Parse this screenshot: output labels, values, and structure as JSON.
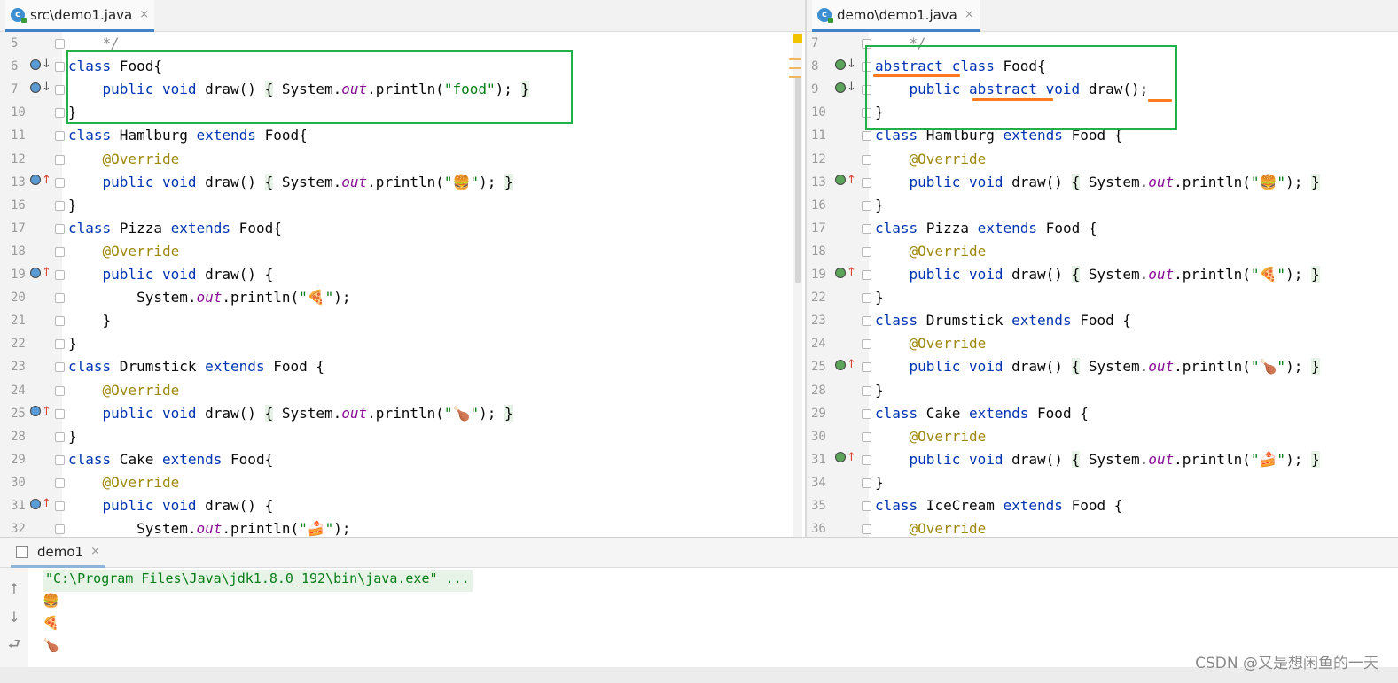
{
  "left_editor": {
    "tab": {
      "icon": "c",
      "filename": "src\\demo1.java",
      "close": "×"
    },
    "lines": [
      {
        "num": "5",
        "parts": [
          [
            "cm",
            "    */"
          ]
        ]
      },
      {
        "num": "6",
        "parts": [
          [
            "kw",
            "class"
          ],
          [
            "t",
            " Food{"
          ]
        ]
      },
      {
        "num": "7",
        "parts": [
          [
            "t",
            "    "
          ],
          [
            "kw",
            "public void"
          ],
          [
            "t",
            " draw() "
          ],
          [
            "fb",
            "{"
          ],
          [
            "t",
            " System."
          ],
          [
            "fld",
            "out"
          ],
          [
            "t",
            ".println("
          ],
          [
            "str",
            "\"food\""
          ],
          [
            "t",
            "); "
          ],
          [
            "fb",
            "}"
          ]
        ]
      },
      {
        "num": "10",
        "parts": [
          [
            "t",
            "}"
          ]
        ]
      },
      {
        "num": "11",
        "parts": [
          [
            "kw",
            "class"
          ],
          [
            "t",
            " Hamlburg "
          ],
          [
            "kw",
            "extends"
          ],
          [
            "t",
            " Food{"
          ]
        ]
      },
      {
        "num": "12",
        "parts": [
          [
            "t",
            "    "
          ],
          [
            "ann",
            "@Override"
          ]
        ]
      },
      {
        "num": "13",
        "parts": [
          [
            "t",
            "    "
          ],
          [
            "kw",
            "public void"
          ],
          [
            "t",
            " draw() "
          ],
          [
            "fb",
            "{"
          ],
          [
            "t",
            " System."
          ],
          [
            "fld",
            "out"
          ],
          [
            "t",
            ".println("
          ],
          [
            "str",
            "\"🍔\""
          ],
          [
            "t",
            "); "
          ],
          [
            "fb",
            "}"
          ]
        ]
      },
      {
        "num": "16",
        "parts": [
          [
            "t",
            "}"
          ]
        ]
      },
      {
        "num": "17",
        "parts": [
          [
            "kw",
            "class"
          ],
          [
            "t",
            " Pizza "
          ],
          [
            "kw",
            "extends"
          ],
          [
            "t",
            " Food{"
          ]
        ]
      },
      {
        "num": "18",
        "parts": [
          [
            "t",
            "    "
          ],
          [
            "ann",
            "@Override"
          ]
        ]
      },
      {
        "num": "19",
        "parts": [
          [
            "t",
            "    "
          ],
          [
            "kw",
            "public void"
          ],
          [
            "t",
            " draw() {"
          ]
        ]
      },
      {
        "num": "20",
        "parts": [
          [
            "t",
            "        System."
          ],
          [
            "fld",
            "out"
          ],
          [
            "t",
            ".println("
          ],
          [
            "str",
            "\"🍕\""
          ],
          [
            "t",
            ");"
          ]
        ]
      },
      {
        "num": "21",
        "parts": [
          [
            "t",
            "    }"
          ]
        ]
      },
      {
        "num": "22",
        "parts": [
          [
            "t",
            "}"
          ]
        ]
      },
      {
        "num": "23",
        "parts": [
          [
            "kw",
            "class"
          ],
          [
            "t",
            " Drumstick "
          ],
          [
            "kw",
            "extends"
          ],
          [
            "t",
            " Food {"
          ]
        ]
      },
      {
        "num": "24",
        "parts": [
          [
            "t",
            "    "
          ],
          [
            "ann",
            "@Override"
          ]
        ]
      },
      {
        "num": "25",
        "parts": [
          [
            "t",
            "    "
          ],
          [
            "kw",
            "public void"
          ],
          [
            "t",
            " draw() "
          ],
          [
            "fb",
            "{"
          ],
          [
            "t",
            " System."
          ],
          [
            "fld",
            "out"
          ],
          [
            "t",
            ".println("
          ],
          [
            "str",
            "\"🍗\""
          ],
          [
            "t",
            "); "
          ],
          [
            "fb",
            "}"
          ]
        ]
      },
      {
        "num": "28",
        "parts": [
          [
            "t",
            "}"
          ]
        ]
      },
      {
        "num": "29",
        "parts": [
          [
            "kw",
            "class"
          ],
          [
            "t",
            " Cake "
          ],
          [
            "kw",
            "extends"
          ],
          [
            "t",
            " Food{"
          ]
        ]
      },
      {
        "num": "30",
        "parts": [
          [
            "t",
            "    "
          ],
          [
            "ann",
            "@Override"
          ]
        ]
      },
      {
        "num": "31",
        "parts": [
          [
            "t",
            "    "
          ],
          [
            "kw",
            "public void"
          ],
          [
            "t",
            " draw() {"
          ]
        ]
      },
      {
        "num": "32",
        "parts": [
          [
            "t",
            "        System."
          ],
          [
            "fld",
            "out"
          ],
          [
            "t",
            ".println("
          ],
          [
            "str",
            "\"🍰\""
          ],
          [
            "t",
            ");"
          ]
        ]
      }
    ]
  },
  "right_editor": {
    "tab": {
      "icon": "c",
      "filename": "demo\\demo1.java",
      "close": "×"
    },
    "lines": [
      {
        "num": "7",
        "parts": [
          [
            "cm",
            "    */"
          ]
        ]
      },
      {
        "num": "8",
        "parts": [
          [
            "kw",
            "abstract class"
          ],
          [
            "t",
            " Food{"
          ]
        ]
      },
      {
        "num": "9",
        "parts": [
          [
            "t",
            "    "
          ],
          [
            "kw",
            "public abstract void"
          ],
          [
            "t",
            " draw();"
          ]
        ]
      },
      {
        "num": "10",
        "parts": [
          [
            "t",
            "}"
          ]
        ]
      },
      {
        "num": "11",
        "parts": [
          [
            "kw",
            "class"
          ],
          [
            "t",
            " Hamlburg "
          ],
          [
            "kw",
            "extends"
          ],
          [
            "t",
            " Food {"
          ]
        ]
      },
      {
        "num": "12",
        "parts": [
          [
            "t",
            "    "
          ],
          [
            "ann",
            "@Override"
          ]
        ]
      },
      {
        "num": "13",
        "parts": [
          [
            "t",
            "    "
          ],
          [
            "kw",
            "public void"
          ],
          [
            "t",
            " draw() "
          ],
          [
            "fb",
            "{"
          ],
          [
            "t",
            " System."
          ],
          [
            "fld",
            "out"
          ],
          [
            "t",
            ".println("
          ],
          [
            "str",
            "\"🍔\""
          ],
          [
            "t",
            "); "
          ],
          [
            "fb",
            "}"
          ]
        ]
      },
      {
        "num": "16",
        "parts": [
          [
            "t",
            "}"
          ]
        ]
      },
      {
        "num": "17",
        "parts": [
          [
            "kw",
            "class"
          ],
          [
            "t",
            " Pizza "
          ],
          [
            "kw",
            "extends"
          ],
          [
            "t",
            " Food {"
          ]
        ]
      },
      {
        "num": "18",
        "parts": [
          [
            "t",
            "    "
          ],
          [
            "ann",
            "@Override"
          ]
        ]
      },
      {
        "num": "19",
        "parts": [
          [
            "t",
            "    "
          ],
          [
            "kw",
            "public void"
          ],
          [
            "t",
            " draw() "
          ],
          [
            "fb",
            "{"
          ],
          [
            "t",
            " System."
          ],
          [
            "fld",
            "out"
          ],
          [
            "t",
            ".println("
          ],
          [
            "str",
            "\"🍕\""
          ],
          [
            "t",
            "); "
          ],
          [
            "fb",
            "}"
          ]
        ]
      },
      {
        "num": "22",
        "parts": [
          [
            "t",
            "}"
          ]
        ]
      },
      {
        "num": "23",
        "parts": [
          [
            "kw",
            "class"
          ],
          [
            "t",
            " Drumstick "
          ],
          [
            "kw",
            "extends"
          ],
          [
            "t",
            " Food {"
          ]
        ]
      },
      {
        "num": "24",
        "parts": [
          [
            "t",
            "    "
          ],
          [
            "ann",
            "@Override"
          ]
        ]
      },
      {
        "num": "25",
        "parts": [
          [
            "t",
            "    "
          ],
          [
            "kw",
            "public void"
          ],
          [
            "t",
            " draw() "
          ],
          [
            "fb",
            "{"
          ],
          [
            "t",
            " System."
          ],
          [
            "fld",
            "out"
          ],
          [
            "t",
            ".println("
          ],
          [
            "str",
            "\"🍗\""
          ],
          [
            "t",
            "); "
          ],
          [
            "fb",
            "}"
          ]
        ]
      },
      {
        "num": "28",
        "parts": [
          [
            "t",
            "}"
          ]
        ]
      },
      {
        "num": "29",
        "parts": [
          [
            "kw",
            "class"
          ],
          [
            "t",
            " Cake "
          ],
          [
            "kw",
            "extends"
          ],
          [
            "t",
            " Food {"
          ]
        ]
      },
      {
        "num": "30",
        "parts": [
          [
            "t",
            "    "
          ],
          [
            "ann",
            "@Override"
          ]
        ]
      },
      {
        "num": "31",
        "parts": [
          [
            "t",
            "    "
          ],
          [
            "kw",
            "public void"
          ],
          [
            "t",
            " draw() "
          ],
          [
            "fb",
            "{"
          ],
          [
            "t",
            " System."
          ],
          [
            "fld",
            "out"
          ],
          [
            "t",
            ".println("
          ],
          [
            "str",
            "\"🍰\""
          ],
          [
            "t",
            "); "
          ],
          [
            "fb",
            "}"
          ]
        ]
      },
      {
        "num": "34",
        "parts": [
          [
            "t",
            "}"
          ]
        ]
      },
      {
        "num": "35",
        "parts": [
          [
            "kw",
            "class"
          ],
          [
            "t",
            " IceCream "
          ],
          [
            "kw",
            "extends"
          ],
          [
            "t",
            " Food {"
          ]
        ]
      },
      {
        "num": "36",
        "parts": [
          [
            "t",
            "    "
          ],
          [
            "ann",
            "@Override"
          ]
        ]
      }
    ]
  },
  "run_panel": {
    "tab": {
      "name": "demo1",
      "close": "×"
    },
    "side_icons": [
      "up-arrow-icon",
      "down-arrow-icon",
      "soft-wrap-icon"
    ],
    "command": "\"C:\\Program Files\\Java\\jdk1.8.0_192\\bin\\java.exe\" ...",
    "output": [
      "🍔",
      "🍕",
      "🍗"
    ]
  },
  "watermark": "CSDN @又是想闲鱼的一天",
  "colors": {
    "keyword": "#0033b3",
    "annotation": "#9e880d",
    "string": "#067d17",
    "field": "#871094",
    "highlight_box": "#21b14b",
    "underline": "#ff7a1f"
  }
}
